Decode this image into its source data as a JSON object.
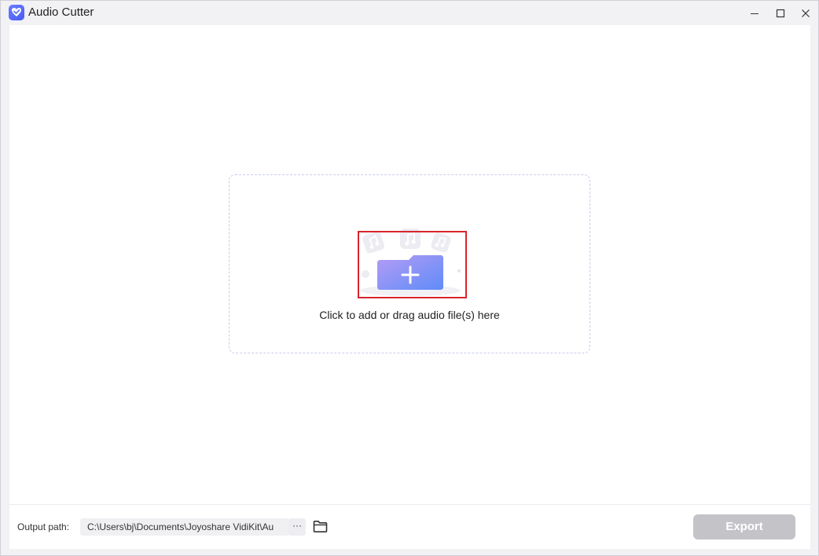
{
  "window": {
    "title": "Audio Cutter"
  },
  "dropzone": {
    "text": "Click to add or drag audio file(s) here"
  },
  "footer": {
    "output_label": "Output path:",
    "output_path": "C:\\Users\\bj\\Documents\\Joyoshare VidiKit\\Au",
    "more_label": "···",
    "export_label": "Export"
  },
  "icons": {
    "app_logo": "heart-check-logo-icon",
    "minimize": "minimize-icon",
    "maximize": "maximize-icon",
    "close": "close-icon",
    "add_folder": "folder-plus-icon",
    "music_notes": "music-note-icon",
    "open_folder": "folder-icon"
  },
  "colors": {
    "accent_gradient_start": "#b59cf6",
    "accent_gradient_end": "#5f8cf7",
    "highlight": "#d8252c",
    "export_disabled": "#c4c4c8",
    "logo": "#5566f5"
  }
}
